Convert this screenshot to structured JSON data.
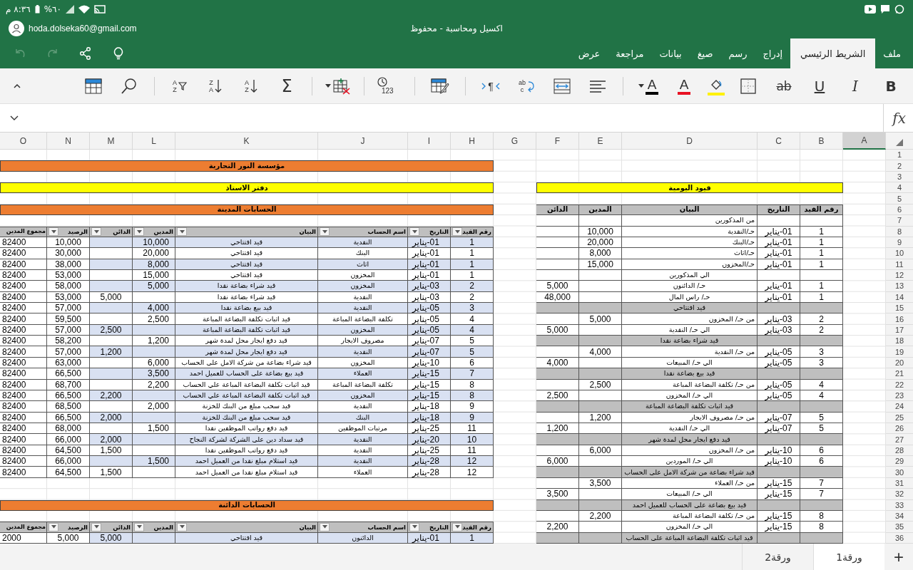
{
  "status_bar": {
    "time": "٨:٣٦ م",
    "battery": "%٦٠"
  },
  "account": {
    "email": "hoda.dolseka60@gmail.com"
  },
  "window": {
    "title": "اكسيل ومحاسبة - محفوظ"
  },
  "quick_actions": [
    {
      "kind": "undo",
      "disabled": true
    },
    {
      "kind": "redo",
      "disabled": true
    },
    {
      "kind": "share",
      "disabled": false
    },
    {
      "kind": "idea",
      "disabled": false
    }
  ],
  "tabs": [
    {
      "label": "ملف",
      "selected": false
    },
    {
      "label": "الشريط الرئيسي",
      "selected": true
    },
    {
      "label": "إدراج",
      "selected": false
    },
    {
      "label": "رسم",
      "selected": false
    },
    {
      "label": "صيغ",
      "selected": false
    },
    {
      "label": "بيانات",
      "selected": false
    },
    {
      "label": "مراجعة",
      "selected": false
    },
    {
      "label": "عرض",
      "selected": false
    }
  ],
  "ribbon": {
    "groups": [
      [
        {
          "kind": "bold",
          "label": "B"
        },
        {
          "kind": "italic",
          "label": "I"
        },
        {
          "kind": "underline",
          "label": "U"
        },
        {
          "kind": "strikethrough",
          "label": "ab"
        },
        {
          "kind": "borders"
        },
        {
          "kind": "highlight",
          "color": "#fff100"
        },
        {
          "kind": "font_color",
          "label": "A",
          "color": "#e81123"
        },
        {
          "kind": "font_color",
          "label": "A",
          "color": "#000000",
          "menu": true
        }
      ],
      [
        {
          "kind": "align"
        },
        {
          "kind": "merge"
        },
        {
          "kind": "wrap",
          "letters": [
            "ab",
            "c"
          ]
        },
        {
          "kind": "text_direction",
          "label": "¶"
        }
      ],
      [
        {
          "kind": "format_table"
        }
      ],
      [
        {
          "kind": "number_format",
          "label": "123"
        }
      ],
      [
        {
          "kind": "cells",
          "menu": true
        }
      ],
      [
        {
          "kind": "autosum",
          "label": "Σ"
        },
        {
          "kind": "sort",
          "letters": [
            "A",
            "Z"
          ]
        },
        {
          "kind": "sort",
          "letters": [
            "Z",
            "A"
          ]
        },
        {
          "kind": "sort_filter",
          "letters": [
            "A",
            "Z"
          ]
        }
      ],
      [
        {
          "kind": "find"
        },
        {
          "kind": "table"
        }
      ]
    ]
  },
  "formula_bar": {
    "fx_label": "fx"
  },
  "column_headers": [
    {
      "label": "A",
      "selected": true
    },
    {
      "label": "B",
      "selected": false
    },
    {
      "label": "C",
      "selected": false
    },
    {
      "label": "D",
      "selected": false
    },
    {
      "label": "E",
      "selected": false
    },
    {
      "label": "F",
      "selected": false
    },
    {
      "label": "G",
      "selected": false
    },
    {
      "label": "H",
      "selected": false
    },
    {
      "label": "I",
      "selected": false
    },
    {
      "label": "J",
      "selected": false
    },
    {
      "label": "K",
      "selected": false
    },
    {
      "label": "L",
      "selected": false
    },
    {
      "label": "M",
      "selected": false
    },
    {
      "label": "N",
      "selected": false
    },
    {
      "label": "O",
      "selected": false
    }
  ],
  "row_numbers": [
    "1",
    "2",
    "3",
    "4",
    "5",
    "6",
    "7",
    "8",
    "9",
    "10",
    "11",
    "12",
    "13",
    "14",
    "15",
    "16",
    "17",
    "18",
    "19",
    "20",
    "21",
    "22",
    "23",
    "24",
    "25",
    "26",
    "27",
    "28",
    "29",
    "30",
    "31",
    "32",
    "33",
    "34",
    "35",
    "36"
  ],
  "ledger": {
    "company": "مؤسسة النور التجارية",
    "title": "دفتر الاستاذ",
    "sections": [
      {
        "title": "الحسابات المدينة",
        "columns": [
          {
            "label": "رقم القيد",
            "filter": true
          },
          {
            "label": "التاريخ",
            "filter": true
          },
          {
            "label": "اسم الحساب",
            "filter": true
          },
          {
            "label": "البيان",
            "filter": true
          },
          {
            "label": "المدين",
            "filter": true
          },
          {
            "label": "الدائن",
            "filter": true
          },
          {
            "label": "الرصيد",
            "filter": true
          },
          {
            "label": "مجموع المدين",
            "filter": false
          }
        ],
        "rows": [
          {
            "no": "1",
            "date": "01-يناير",
            "account": "النقدية",
            "desc": "قيد افتتاحي",
            "debit": "10,000",
            "balance": "10,000",
            "total": "82400"
          },
          {
            "no": "1",
            "date": "01-يناير",
            "account": "البنك",
            "desc": "قيد افتتاحي",
            "debit": "20,000",
            "balance": "30,000",
            "total": "82400"
          },
          {
            "no": "1",
            "date": "01-يناير",
            "account": "اثاث",
            "desc": "قيد افتتاحي",
            "debit": "8,000",
            "balance": "38,000",
            "total": "82400"
          },
          {
            "no": "1",
            "date": "01-يناير",
            "account": "المخزون",
            "desc": "قيد افتتاحي",
            "debit": "15,000",
            "balance": "53,000",
            "total": "82400"
          },
          {
            "no": "2",
            "date": "03-يناير",
            "account": "المخزون",
            "desc": "قيد شراء بضاعة نقدا",
            "debit": "5,000",
            "balance": "58,000",
            "total": "82400"
          },
          {
            "no": "2",
            "date": "03-يناير",
            "account": "النقدية",
            "desc": "قيد شراء بضاعة نقدا",
            "credit": "5,000",
            "balance": "53,000",
            "total": "82400"
          },
          {
            "no": "3",
            "date": "05-يناير",
            "account": "النقدية",
            "desc": "قيد بيع بضاعة نقدا",
            "debit": "4,000",
            "balance": "57,000",
            "total": "82400"
          },
          {
            "no": "4",
            "date": "05-يناير",
            "account": "تكلفة البضاعة المباعة",
            "desc": "قيد اثبات تكلفة البضاعة المباعة",
            "debit": "2,500",
            "balance": "59,500",
            "total": "82400"
          },
          {
            "no": "4",
            "date": "05-يناير",
            "account": "المخزون",
            "desc": "قيد اثبات تكلفة البضاعة المباعة",
            "credit": "2,500",
            "balance": "57,000",
            "total": "82400"
          },
          {
            "no": "5",
            "date": "07-يناير",
            "account": "مصروف الايجار",
            "desc": "قيد دفع ايجار محل لمدة شهر",
            "debit": "1,200",
            "balance": "58,200",
            "total": "82400"
          },
          {
            "no": "5",
            "date": "07-يناير",
            "account": "النقدية",
            "desc": "قيد دفع ايجار محل لمدة شهر",
            "credit": "1,200",
            "balance": "57,000",
            "total": "82400"
          },
          {
            "no": "6",
            "date": "10-يناير",
            "account": "المخزون",
            "desc": "قيد شراء بضاعة من شركة الامل على الحساب",
            "debit": "6,000",
            "balance": "63,000",
            "total": "82400"
          },
          {
            "no": "7",
            "date": "15-يناير",
            "account": "العملاء",
            "desc": "قيد بيع بضاعة على الحساب للعميل احمد",
            "debit": "3,500",
            "balance": "66,500",
            "total": "82400"
          },
          {
            "no": "8",
            "date": "15-يناير",
            "account": "تكلفة البضاعة المباعة",
            "desc": "قيد اثبات تكلفة البضاعة المباعة علي الحساب",
            "debit": "2,200",
            "balance": "68,700",
            "total": "82400"
          },
          {
            "no": "8",
            "date": "15-يناير",
            "account": "المخزون",
            "desc": "قيد اثبات تكلفة البضاعة المباعة علي الحساب",
            "credit": "2,200",
            "balance": "66,500",
            "total": "82400"
          },
          {
            "no": "9",
            "date": "18-يناير",
            "account": "النقدية",
            "desc": "قيد سحب مبلغ من البنك للخزنة",
            "debit": "2,000",
            "balance": "68,500",
            "total": "82400"
          },
          {
            "no": "9",
            "date": "18-يناير",
            "account": "البنك",
            "desc": "قيد سحب مبلغ من البنك للخزنة",
            "credit": "2,000",
            "balance": "66,500",
            "total": "82400"
          },
          {
            "no": "11",
            "date": "25-يناير",
            "account": "مرتبات الموظفين",
            "desc": "قيد دفع رواتب الموظفين نقدا",
            "debit": "1,500",
            "balance": "68,000",
            "total": "82400"
          },
          {
            "no": "10",
            "date": "20-يناير",
            "account": "النقدية",
            "desc": "قيد سداد دين على الشركة لشركة النجاح",
            "credit": "2,000",
            "balance": "66,000",
            "total": "82400"
          },
          {
            "no": "11",
            "date": "25-يناير",
            "account": "النقدية",
            "desc": "قيد دفع رواتب الموظفين نقدا",
            "credit": "1,500",
            "balance": "64,500",
            "total": "82400"
          },
          {
            "no": "12",
            "date": "28-يناير",
            "account": "النقدية",
            "desc": "قيد استلام مبلغ نقدا من العميل احمد",
            "debit": "1,500",
            "balance": "66,000",
            "total": "82400"
          },
          {
            "no": "12",
            "date": "28-يناير",
            "account": "العملاء",
            "desc": "قيد استلام مبلغ نقدا من العميل احمد",
            "credit": "1,500",
            "balance": "64,500",
            "total": "82400"
          }
        ]
      },
      {
        "title": "الحسابات الدائنة",
        "columns": [
          {
            "label": "رقم القيد",
            "filter": true
          },
          {
            "label": "التاريخ",
            "filter": true
          },
          {
            "label": "اسم الحساب",
            "filter": true
          },
          {
            "label": "البيان",
            "filter": true
          },
          {
            "label": "المدين",
            "filter": true
          },
          {
            "label": "الدائن",
            "filter": true
          },
          {
            "label": "الرصيد",
            "filter": true
          },
          {
            "label": "مجموع المدين",
            "filter": false
          }
        ],
        "rows": [
          {
            "no": "1",
            "date": "01-يناير",
            "account": "الدائنون",
            "desc": "قيد افتتاحي",
            "credit": "5,000",
            "balance": "5,000",
            "total": "2000"
          }
        ]
      }
    ]
  },
  "journal": {
    "title": "قيود اليومية",
    "columns": [
      "رقم القيد",
      "التاريخ",
      "البيان",
      "المدين",
      "الدائن"
    ],
    "rows": [
      {
        "kind": "debit",
        "desc": "من المذكورين"
      },
      {
        "kind": "debit",
        "no": "1",
        "date": "01-يناير",
        "desc": "حـ/النقدية",
        "debit": "10,000"
      },
      {
        "kind": "debit",
        "no": "1",
        "date": "01-يناير",
        "desc": "حـ/البنك",
        "debit": "20,000"
      },
      {
        "kind": "debit",
        "no": "1",
        "date": "01-يناير",
        "desc": "حـ/اثاث",
        "debit": "8,000"
      },
      {
        "kind": "debit",
        "no": "1",
        "date": "01-يناير",
        "desc": "حـ/المخزون",
        "debit": "15,000"
      },
      {
        "kind": "credit",
        "desc": "الي المذكورين"
      },
      {
        "kind": "credit",
        "no": "1",
        "date": "01-يناير",
        "desc": "حـ/ الدائنون",
        "credit": "5,000"
      },
      {
        "kind": "credit",
        "no": "1",
        "date": "01-يناير",
        "desc": "حـ/ راس المال",
        "credit": "48,000"
      },
      {
        "kind": "caption",
        "desc": "قيد افتتاحي"
      },
      {
        "kind": "debit",
        "no": "2",
        "date": "03-يناير",
        "desc": "من حـ/ المخزون",
        "debit": "5,000"
      },
      {
        "kind": "credit",
        "no": "2",
        "date": "03-يناير",
        "desc": "الي حـ/ النقدية",
        "credit": "5,000"
      },
      {
        "kind": "caption",
        "desc": "قيد شراء بضاعة نقدا"
      },
      {
        "kind": "debit",
        "no": "3",
        "date": "05-يناير",
        "desc": "من حـ/ النقدية",
        "debit": "4,000"
      },
      {
        "kind": "credit",
        "no": "3",
        "date": "05-يناير",
        "desc": "الي حـ/ المبيعات",
        "credit": "4,000"
      },
      {
        "kind": "caption",
        "desc": "قيد بيع بضاعة نقدا"
      },
      {
        "kind": "debit",
        "no": "4",
        "date": "05-يناير",
        "desc": "من حـ/ تكلفة البضاعة المباعة",
        "debit": "2,500"
      },
      {
        "kind": "credit",
        "no": "4",
        "date": "05-يناير",
        "desc": "الي حـ/ المخزون",
        "credit": "2,500"
      },
      {
        "kind": "caption",
        "desc": "قيد اثبات تكلفة البضاعة المباعة"
      },
      {
        "kind": "debit",
        "no": "5",
        "date": "07-يناير",
        "desc": "من حـ/ مصروف الايجار",
        "debit": "1,200"
      },
      {
        "kind": "credit",
        "no": "5",
        "date": "07-يناير",
        "desc": "الي حـ/ النقدية",
        "credit": "1,200"
      },
      {
        "kind": "caption",
        "desc": "قيد دفع ايجار محل لمدة شهر"
      },
      {
        "kind": "debit",
        "no": "6",
        "date": "10-يناير",
        "desc": "من حـ/ المخزون",
        "debit": "6,000"
      },
      {
        "kind": "credit",
        "no": "6",
        "date": "10-يناير",
        "desc": "الي حـ/ الموردين",
        "credit": "6,000"
      },
      {
        "kind": "caption",
        "desc": "قيد شراء بضاعة من شركة الامل على الحساب"
      },
      {
        "kind": "debit",
        "no": "7",
        "date": "15-يناير",
        "desc": "من حـ/ العملاء",
        "debit": "3,500"
      },
      {
        "kind": "credit",
        "no": "7",
        "date": "15-يناير",
        "desc": "الي حـ/ المبيعات",
        "credit": "3,500"
      },
      {
        "kind": "caption",
        "desc": "قيد بيع بضاعة على الحساب للعميل احمد"
      },
      {
        "kind": "debit",
        "no": "8",
        "date": "15-يناير",
        "desc": "من حـ/ تكلفة البضاعة المباعة",
        "debit": "2,200"
      },
      {
        "kind": "credit",
        "no": "8",
        "date": "15-يناير",
        "desc": "الي حـ/ المخزون",
        "credit": "2,200"
      },
      {
        "kind": "caption",
        "desc": "قيد اثبات تكلفة البضاعة المباعة على الحساب"
      }
    ]
  },
  "sheet_tabs": {
    "add_label": "+",
    "tabs": [
      {
        "label": "ورقة1",
        "selected": true
      },
      {
        "label": "ورقة2",
        "selected": false
      }
    ]
  }
}
